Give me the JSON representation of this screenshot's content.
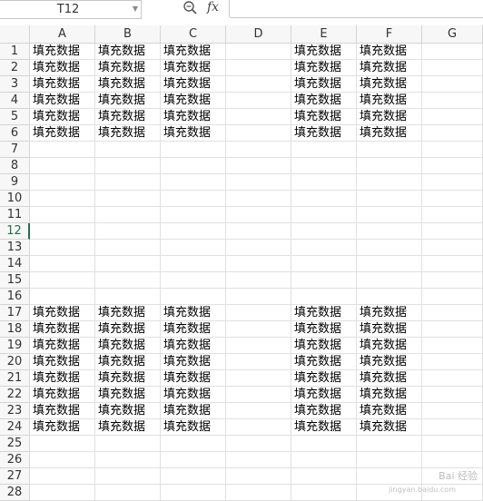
{
  "formula_bar": {
    "name_box": "T12",
    "formula": ""
  },
  "columns": [
    "A",
    "B",
    "C",
    "D",
    "E",
    "F",
    "G"
  ],
  "active_row": 12,
  "fill_text": "填充数据",
  "rows": [
    {
      "num": "1",
      "cells": [
        "填充数据",
        "填充数据",
        "填充数据",
        "",
        "填充数据",
        "填充数据",
        ""
      ]
    },
    {
      "num": "2",
      "cells": [
        "填充数据",
        "填充数据",
        "填充数据",
        "",
        "填充数据",
        "填充数据",
        ""
      ]
    },
    {
      "num": "3",
      "cells": [
        "填充数据",
        "填充数据",
        "填充数据",
        "",
        "填充数据",
        "填充数据",
        ""
      ]
    },
    {
      "num": "4",
      "cells": [
        "填充数据",
        "填充数据",
        "填充数据",
        "",
        "填充数据",
        "填充数据",
        ""
      ]
    },
    {
      "num": "5",
      "cells": [
        "填充数据",
        "填充数据",
        "填充数据",
        "",
        "填充数据",
        "填充数据",
        ""
      ]
    },
    {
      "num": "6",
      "cells": [
        "填充数据",
        "填充数据",
        "填充数据",
        "",
        "填充数据",
        "填充数据",
        ""
      ]
    },
    {
      "num": "7",
      "cells": [
        "",
        "",
        "",
        "",
        "",
        "",
        ""
      ]
    },
    {
      "num": "8",
      "cells": [
        "",
        "",
        "",
        "",
        "",
        "",
        ""
      ]
    },
    {
      "num": "9",
      "cells": [
        "",
        "",
        "",
        "",
        "",
        "",
        ""
      ]
    },
    {
      "num": "10",
      "cells": [
        "",
        "",
        "",
        "",
        "",
        "",
        ""
      ]
    },
    {
      "num": "11",
      "cells": [
        "",
        "",
        "",
        "",
        "",
        "",
        ""
      ]
    },
    {
      "num": "12",
      "cells": [
        "",
        "",
        "",
        "",
        "",
        "",
        ""
      ]
    },
    {
      "num": "13",
      "cells": [
        "",
        "",
        "",
        "",
        "",
        "",
        ""
      ]
    },
    {
      "num": "14",
      "cells": [
        "",
        "",
        "",
        "",
        "",
        "",
        ""
      ]
    },
    {
      "num": "15",
      "cells": [
        "",
        "",
        "",
        "",
        "",
        "",
        ""
      ]
    },
    {
      "num": "16",
      "cells": [
        "",
        "",
        "",
        "",
        "",
        "",
        ""
      ]
    },
    {
      "num": "17",
      "cells": [
        "填充数据",
        "填充数据",
        "填充数据",
        "",
        "填充数据",
        "填充数据",
        ""
      ]
    },
    {
      "num": "18",
      "cells": [
        "填充数据",
        "填充数据",
        "填充数据",
        "",
        "填充数据",
        "填充数据",
        ""
      ]
    },
    {
      "num": "19",
      "cells": [
        "填充数据",
        "填充数据",
        "填充数据",
        "",
        "填充数据",
        "填充数据",
        ""
      ]
    },
    {
      "num": "20",
      "cells": [
        "填充数据",
        "填充数据",
        "填充数据",
        "",
        "填充数据",
        "填充数据",
        ""
      ]
    },
    {
      "num": "21",
      "cells": [
        "填充数据",
        "填充数据",
        "填充数据",
        "",
        "填充数据",
        "填充数据",
        ""
      ]
    },
    {
      "num": "22",
      "cells": [
        "填充数据",
        "填充数据",
        "填充数据",
        "",
        "填充数据",
        "填充数据",
        ""
      ]
    },
    {
      "num": "23",
      "cells": [
        "填充数据",
        "填充数据",
        "填充数据",
        "",
        "填充数据",
        "填充数据",
        ""
      ]
    },
    {
      "num": "24",
      "cells": [
        "填充数据",
        "填充数据",
        "填充数据",
        "",
        "填充数据",
        "填充数据",
        ""
      ]
    },
    {
      "num": "25",
      "cells": [
        "",
        "",
        "",
        "",
        "",
        "",
        ""
      ]
    },
    {
      "num": "26",
      "cells": [
        "",
        "",
        "",
        "",
        "",
        "",
        ""
      ]
    },
    {
      "num": "27",
      "cells": [
        "",
        "",
        "",
        "",
        "",
        "",
        ""
      ]
    },
    {
      "num": "28",
      "cells": [
        "",
        "",
        "",
        "",
        "",
        "",
        ""
      ]
    }
  ],
  "watermark": {
    "text": "Bai 经验",
    "sub": "jingyan.baidu.com"
  },
  "colors": {
    "header_bg": "#f7f7f7",
    "grid_line": "#e0e0e0",
    "active_green": "#217346"
  }
}
